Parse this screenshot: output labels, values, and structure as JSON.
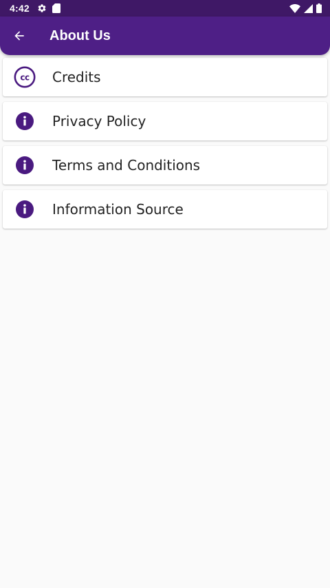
{
  "status_bar": {
    "time": "4:42",
    "left_icons": [
      "settings-icon",
      "sd-card-icon"
    ],
    "right_icons": [
      "wifi-icon",
      "signal-icon",
      "battery-icon"
    ]
  },
  "app_bar": {
    "title": "About Us",
    "back_icon": "arrow-back-icon"
  },
  "menu": {
    "items": [
      {
        "label": "Credits",
        "icon": "creative-commons-icon"
      },
      {
        "label": "Privacy Policy",
        "icon": "info-icon"
      },
      {
        "label": "Terms and Conditions",
        "icon": "info-icon"
      },
      {
        "label": "Information Source",
        "icon": "info-icon"
      }
    ]
  },
  "colors": {
    "status_bar": "#3f1866",
    "app_bar": "#4e1f86",
    "icon_accent": "#4a1a80",
    "background": "#fafafa",
    "card": "#ffffff"
  }
}
